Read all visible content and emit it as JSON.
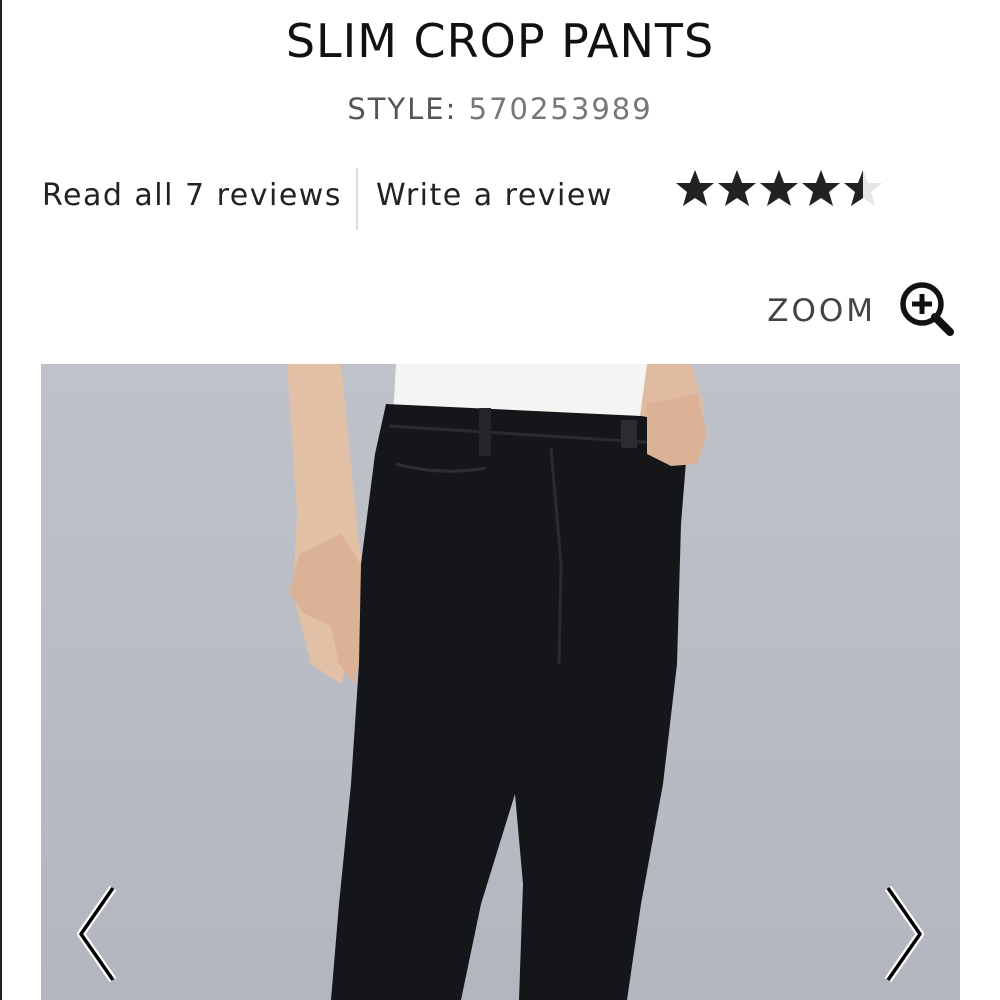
{
  "product": {
    "title": "SLIM CROP PANTS",
    "style_label": "STYLE:",
    "style_number": "570253989"
  },
  "reviews": {
    "read_label": "Read all 7 reviews",
    "write_label": "Write a review",
    "rating": 4.5,
    "max_rating": 5,
    "star_color": "#222222"
  },
  "zoom": {
    "label": "ZOOM",
    "icon": "zoom-in-icon"
  },
  "gallery": {
    "background_color": "#b9bcc4",
    "prev_icon": "chevron-left-icon",
    "next_icon": "chevron-right-icon"
  }
}
